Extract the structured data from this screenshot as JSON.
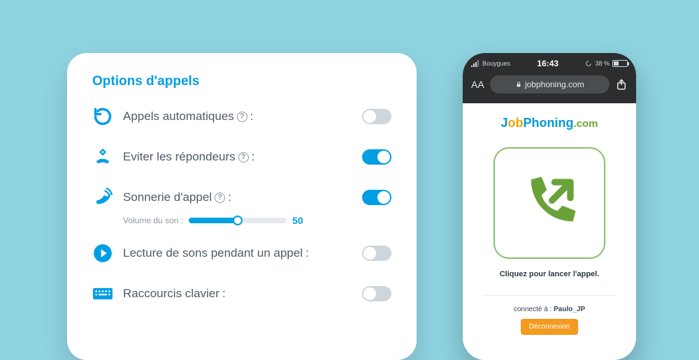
{
  "settings": {
    "title": "Options d'appels",
    "options": [
      {
        "icon": "refresh",
        "label": "Appels automatiques",
        "help": true,
        "colon": " :",
        "on": false
      },
      {
        "icon": "avoid-answer",
        "label": "Eviter les répondeurs",
        "help": true,
        "colon": " :",
        "on": true
      },
      {
        "icon": "ringing-phone",
        "label": "Sonnerie d'appel",
        "help": true,
        "colon": " :",
        "on": true,
        "volume": {
          "label": "Volume du son :",
          "value": 50
        }
      },
      {
        "icon": "play",
        "label": "Lecture de sons pendant un appel",
        "help": false,
        "colon": " :",
        "on": false
      },
      {
        "icon": "keyboard",
        "label": "Raccourcis clavier",
        "help": false,
        "colon": " :",
        "on": false
      }
    ]
  },
  "phone": {
    "carrier": "Bouygues",
    "time": "16:43",
    "battery_pct": "38 %",
    "url": "jobphoning.com",
    "brand": {
      "j": "J",
      "ob": "ob",
      "ph": "Phoning",
      "com": ".com"
    },
    "call_hint": "Cliquez pour lancer l'appel.",
    "connected_prefix": "connecté à : ",
    "connected_user": "Paulo_JP",
    "logout": "Déconnexion"
  },
  "colors": {
    "accent": "#009fe3",
    "green": "#6aa23a",
    "orange": "#f39a1f"
  }
}
